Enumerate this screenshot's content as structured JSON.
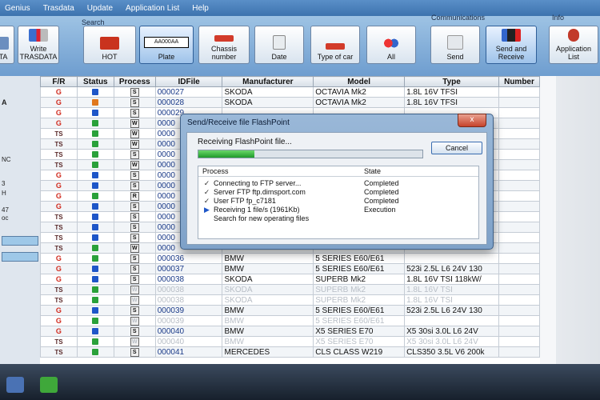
{
  "menu": [
    "Genius",
    "Trasdata",
    "Update",
    "Application List",
    "Help"
  ],
  "toolbar": {
    "left_buttons": [
      {
        "label": "TA"
      },
      {
        "label": "Write TRASDATA"
      }
    ],
    "search_label": "Search",
    "search_buttons": [
      {
        "label": "HOT"
      },
      {
        "label": "Plate",
        "plate_text": "AA000AA"
      },
      {
        "label": "Chassis number"
      },
      {
        "label": "Date"
      },
      {
        "label": "Type of car"
      },
      {
        "label": "All"
      }
    ],
    "comm_label": "Communications",
    "comm_buttons": [
      {
        "label": "Send"
      },
      {
        "label": "Send and Receive"
      }
    ],
    "info_label": "Info",
    "info_buttons": [
      {
        "label": "Application List"
      }
    ]
  },
  "sidebar": {
    "items": [
      "A",
      "NC",
      "3",
      "H",
      "47",
      "oc"
    ]
  },
  "table": {
    "columns": [
      "F/R",
      "Status",
      "Process",
      "IDFile",
      "Manufacturer",
      "Model",
      "Type",
      "Number"
    ],
    "rows": [
      {
        "fr": "G",
        "status": "blue",
        "proc": "S",
        "id": "000027",
        "mfr": "SKODA",
        "model": "OCTAVIA Mk2",
        "type": "1.8L 16V TFSI"
      },
      {
        "fr": "G",
        "status": "orange",
        "proc": "S",
        "id": "000028",
        "mfr": "SKODA",
        "model": "OCTAVIA Mk2",
        "type": "1.8L 16V TFSI"
      },
      {
        "fr": "G",
        "status": "blue",
        "proc": "S",
        "id": "000029",
        "mfr": "",
        "model": "",
        "type": ""
      },
      {
        "fr": "G",
        "status": "green",
        "proc": "W",
        "id": "0000",
        "mfr": "",
        "model": "",
        "type": ""
      },
      {
        "fr": "TS",
        "status": "green",
        "proc": "W",
        "id": "0000",
        "mfr": "",
        "model": "",
        "type": ""
      },
      {
        "fr": "TS",
        "status": "green",
        "proc": "W",
        "id": "0000",
        "mfr": "",
        "model": "",
        "type": ""
      },
      {
        "fr": "TS",
        "status": "green",
        "proc": "S",
        "id": "0000",
        "mfr": "",
        "model": "",
        "type": ""
      },
      {
        "fr": "TS",
        "status": "green",
        "proc": "W",
        "id": "0000",
        "mfr": "",
        "model": "",
        "type": ""
      },
      {
        "fr": "G",
        "status": "blue",
        "proc": "S",
        "id": "0000",
        "mfr": "",
        "model": "",
        "type": ""
      },
      {
        "fr": "G",
        "status": "blue",
        "proc": "S",
        "id": "0000",
        "mfr": "",
        "model": "",
        "type": ""
      },
      {
        "fr": "G",
        "status": "green",
        "proc": "R",
        "id": "0000",
        "mfr": "",
        "model": "",
        "type": ""
      },
      {
        "fr": "G",
        "status": "blue",
        "proc": "S",
        "id": "0000",
        "mfr": "",
        "model": "",
        "type": ""
      },
      {
        "fr": "TS",
        "status": "blue",
        "proc": "S",
        "id": "0000",
        "mfr": "",
        "model": "",
        "type": ""
      },
      {
        "fr": "TS",
        "status": "blue",
        "proc": "S",
        "id": "0000",
        "mfr": "",
        "model": "",
        "type": ""
      },
      {
        "fr": "TS",
        "status": "blue",
        "proc": "S",
        "id": "0000",
        "mfr": "",
        "model": "",
        "type": ""
      },
      {
        "fr": "TS",
        "status": "green",
        "proc": "W",
        "id": "0000",
        "mfr": "",
        "model": "",
        "type": ""
      },
      {
        "fr": "G",
        "status": "green",
        "proc": "S",
        "id": "000036",
        "mfr": "BMW",
        "model": "5 SERIES E60/E61",
        "type": ""
      },
      {
        "fr": "G",
        "status": "blue",
        "proc": "S",
        "id": "000037",
        "mfr": "BMW",
        "model": "5 SERIES E60/E61",
        "type": "523i 2.5L L6 24V 130"
      },
      {
        "fr": "G",
        "status": "blue",
        "proc": "S",
        "id": "000038",
        "mfr": "SKODA",
        "model": "SUPERB Mk2",
        "type": "1.8L 16V TSI 118kW/"
      },
      {
        "fr": "TS",
        "status": "green",
        "proc": "W",
        "id": "000038",
        "mfr": "SKODA",
        "model": "SUPERB Mk2",
        "type": "1.8L 16V TSI",
        "faded": true
      },
      {
        "fr": "TS",
        "status": "green",
        "proc": "W",
        "id": "000038",
        "mfr": "SKODA",
        "model": "SUPERB Mk2",
        "type": "1.8L 16V TSI",
        "faded": true
      },
      {
        "fr": "G",
        "status": "blue",
        "proc": "S",
        "id": "000039",
        "mfr": "BMW",
        "model": "5 SERIES E60/E61",
        "type": "523i 2.5L L6 24V 130"
      },
      {
        "fr": "G",
        "status": "green",
        "proc": "W",
        "id": "000039",
        "mfr": "BMW",
        "model": "5 SERIES E60/E61",
        "type": "",
        "faded": true
      },
      {
        "fr": "G",
        "status": "blue",
        "proc": "S",
        "id": "000040",
        "mfr": "BMW",
        "model": "X5 SERIES E70",
        "type": "X5 30si 3.0L L6 24V"
      },
      {
        "fr": "TS",
        "status": "green",
        "proc": "W",
        "id": "000040",
        "mfr": "BMW",
        "model": "X5 SERIES E70",
        "type": "X5 30si 3.0L L6 24V",
        "faded": true
      },
      {
        "fr": "TS",
        "status": "green",
        "proc": "S",
        "id": "000041",
        "mfr": "MERCEDES",
        "model": "CLS CLASS W219",
        "type": "CLS350 3.5L V6 200k"
      }
    ]
  },
  "dialog": {
    "title": "Send/Receive file FlashPoint",
    "close_symbol": "x",
    "receiving_text": "Receiving FlashPoint file...",
    "progress": 0.25,
    "cancel_label": "Cancel",
    "process_header": "Process",
    "state_header": "State",
    "steps": [
      {
        "mark": "✓",
        "text": "Connecting to FTP server...",
        "state": "Completed"
      },
      {
        "mark": "✓",
        "text": "Server FTP ftp.dimsport.com",
        "state": "Completed"
      },
      {
        "mark": "✓",
        "text": "User FTP fp_c7181",
        "state": "Completed"
      },
      {
        "mark": "▶",
        "text": "Receiving 1 file/s (1961Kb)",
        "state": "Execution"
      },
      {
        "mark": "",
        "text": "Search for new operating files",
        "state": ""
      }
    ]
  },
  "colors": {
    "status_blue": "#1e56c8",
    "status_green": "#2aa13a",
    "status_orange": "#e0781e",
    "accent": "#3d73ae"
  }
}
